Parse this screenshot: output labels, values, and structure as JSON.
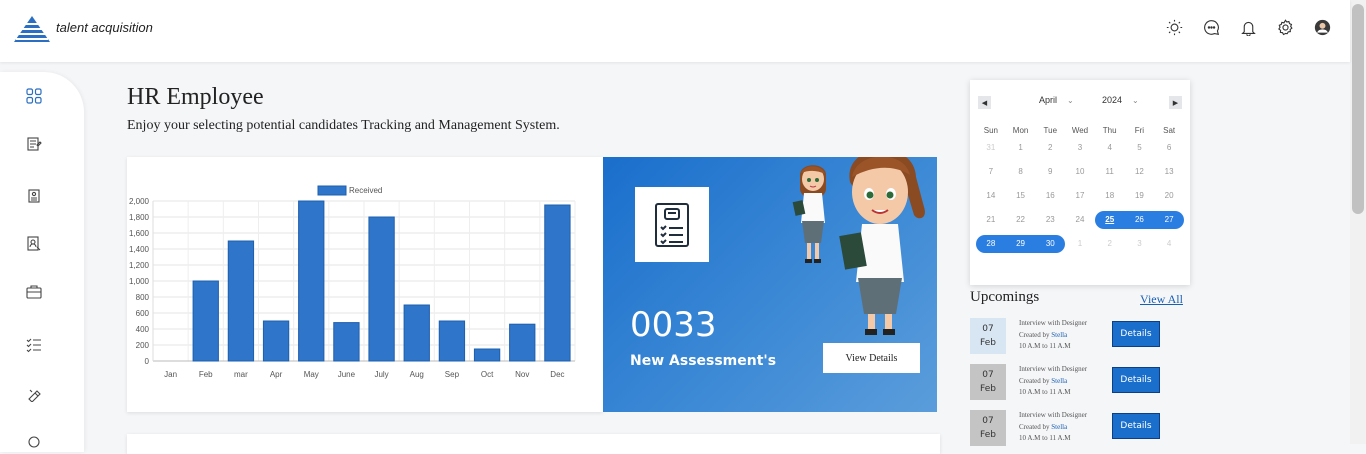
{
  "app": {
    "brand": "talent acquisition"
  },
  "header": {
    "icons": [
      "sun-icon",
      "chat-icon",
      "bell-icon",
      "gear-icon",
      "avatar"
    ]
  },
  "sidebar": {
    "items": [
      "dashboard-icon",
      "job-post-icon",
      "resume-icon",
      "candidate-profile-icon",
      "briefcase-icon",
      "checklist-icon",
      "interview-icon",
      "more-icon"
    ]
  },
  "page": {
    "title": "HR Employee",
    "subtitle": "Enjoy your selecting potential candidates Tracking and Management System."
  },
  "chart_data": {
    "type": "bar",
    "categories": [
      "Jan",
      "Feb",
      "mar",
      "Apr",
      "May",
      "June",
      "July",
      "Aug",
      "Sep",
      "Oct",
      "Nov",
      "Dec"
    ],
    "series": [
      {
        "name": "Received",
        "values": [
          0,
          1000,
          1500,
          500,
          2000,
          480,
          1800,
          700,
          500,
          150,
          460,
          1950
        ],
        "color": "#2f75c9"
      }
    ],
    "yticks": [
      "0",
      "200",
      "400",
      "600",
      "800",
      "1,000",
      "1,200",
      "1,400",
      "1,600",
      "1,800",
      "2,000"
    ],
    "ylim": [
      0,
      2000
    ],
    "grid": true,
    "legend": "top-center"
  },
  "assessment": {
    "count": "0033",
    "label": "New Assessment's",
    "button": "View Details"
  },
  "calendar": {
    "month": "April",
    "year": "2024",
    "weekdays": [
      "Sun",
      "Mon",
      "Tue",
      "Wed",
      "Thu",
      "Fri",
      "Sat"
    ],
    "weeks": [
      [
        "31",
        "1",
        "2",
        "3",
        "4",
        "5",
        "6"
      ],
      [
        "7",
        "8",
        "9",
        "10",
        "11",
        "12",
        "13"
      ],
      [
        "14",
        "15",
        "16",
        "17",
        "18",
        "19",
        "20"
      ],
      [
        "21",
        "22",
        "23",
        "24",
        "25",
        "26",
        "27"
      ],
      [
        "28",
        "29",
        "30",
        "1",
        "2",
        "3",
        "4"
      ]
    ],
    "today": "25",
    "selected_range": [
      "25",
      "30"
    ],
    "accent": "#2a7de1"
  },
  "upcomings": {
    "title": "Upcomings",
    "view_all": "View All",
    "items": [
      {
        "day": "07",
        "month": "Feb",
        "title": "Interview with Designer",
        "created_prefix": "Created by",
        "created_by": "Stella",
        "time": "10 A.M to 11 A.M",
        "button": "Details",
        "date_bg": "#d8e6f3"
      },
      {
        "day": "07",
        "month": "Feb",
        "title": "Interview with Designer",
        "created_prefix": "Created by",
        "created_by": "Stella",
        "time": "10 A.M to 11 A.M",
        "button": "Details",
        "date_bg": "#c4c4c4"
      },
      {
        "day": "07",
        "month": "Feb",
        "title": "Interview with Designer",
        "created_prefix": "Created by",
        "created_by": "Stella",
        "time": "10 A.M to 11 A.M",
        "button": "Details",
        "date_bg": "#c4c4c4"
      }
    ]
  }
}
